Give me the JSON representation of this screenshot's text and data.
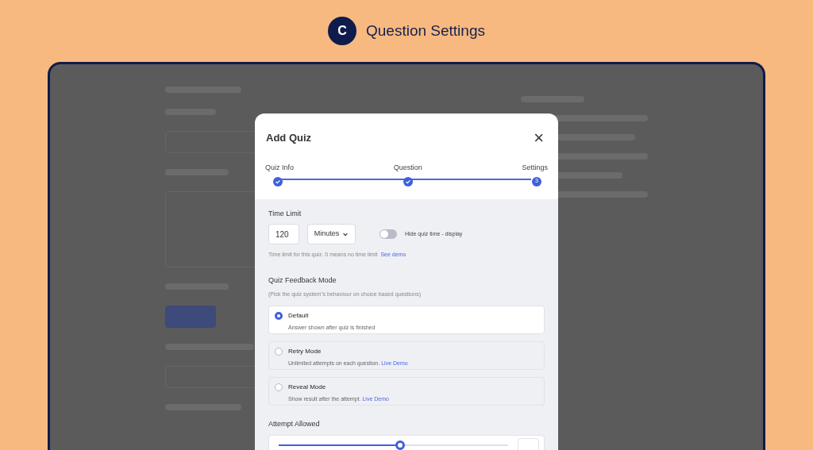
{
  "header": {
    "logo_letter": "C",
    "title": "Question Settings"
  },
  "modal": {
    "title": "Add Quiz",
    "close": "×",
    "steps": [
      {
        "label": "Quiz Info",
        "completed": true
      },
      {
        "label": "Question",
        "completed": true
      },
      {
        "label": "Settings",
        "completed": false,
        "number": "3"
      }
    ],
    "time_limit": {
      "label": "Time Limit",
      "value": "120",
      "unit": "Minutes",
      "toggle_label": "Hide quiz time - display",
      "toggle_on": false,
      "hint": "Time limit for this quiz. 0 means no time limit",
      "hint_link": "See demo"
    },
    "feedback": {
      "label": "Quiz Feedback Mode",
      "subtitle": "(Pick the quiz system\"s behaviour on choice based questions)",
      "options": [
        {
          "title": "Default",
          "description": "Answer shown after quiz is finished",
          "selected": true
        },
        {
          "title": "Retry Mode",
          "description": "Unlimited attempts on each question.",
          "link": "Live Demo",
          "selected": false
        },
        {
          "title": "Reveal Mode",
          "description": "Show result after the attempt.",
          "link": "Live Demo",
          "selected": false
        }
      ]
    },
    "attempts": {
      "label": "Attempt Allowed",
      "level": 0.53
    }
  }
}
